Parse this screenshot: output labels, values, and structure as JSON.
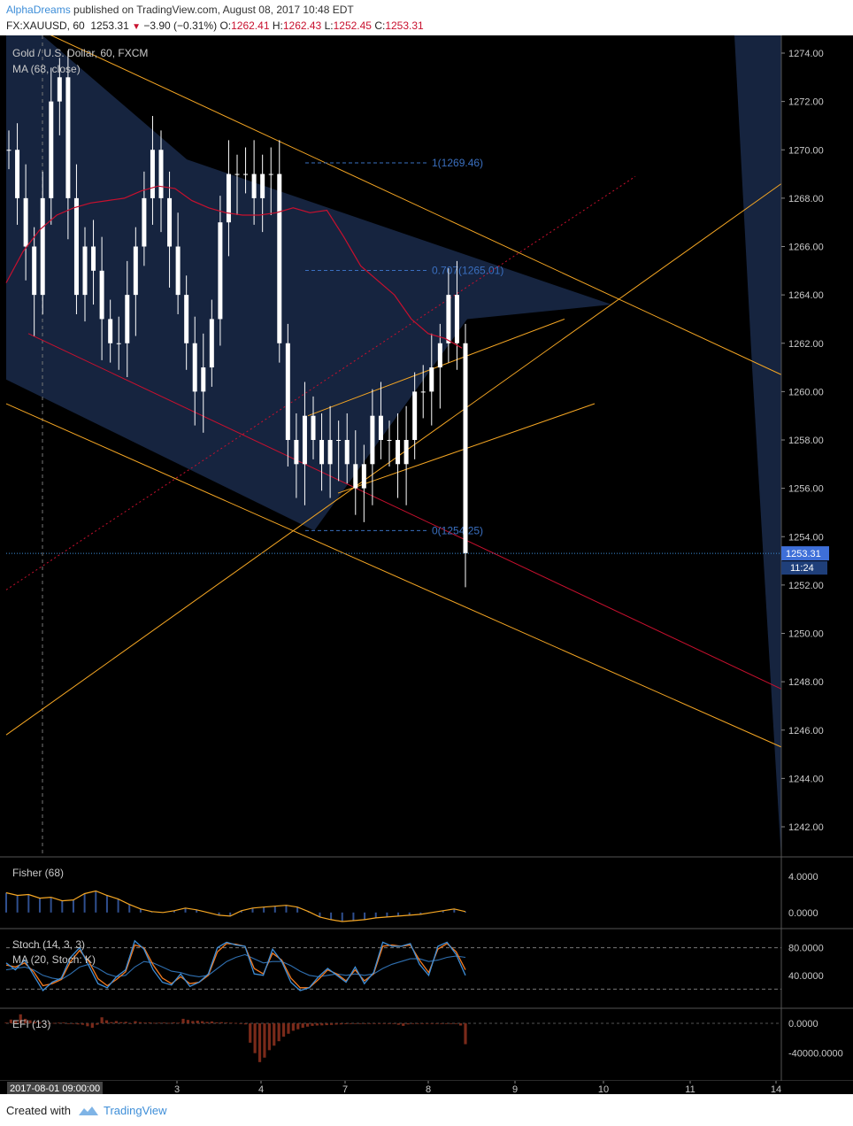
{
  "header": {
    "author": "AlphaDreams",
    "published_text": "published on TradingView.com, August 08, 2017 10:48 EDT",
    "symbol": "FX:XAUUSD, 60",
    "last": "1253.31",
    "change": "−3.90 (−0.31%)",
    "o_label": "O:",
    "o_value": "1262.41",
    "h_label": "H:",
    "h_value": "1262.43",
    "l_label": "L:",
    "l_value": "1252.45",
    "c_label": "C:",
    "c_value": "1253.31"
  },
  "footer": {
    "created_with": "Created with",
    "brand": "TradingView"
  },
  "colors": {
    "background": "#000000",
    "channel_fill": "#16243f",
    "candle": "#ffffff",
    "trendline": "#f5a623",
    "ma_line": "#c8102e",
    "fib": "#3a6fbf",
    "stoch_k": "#3e8ed8",
    "stoch_d": "#f47b20",
    "efi_bar": "#7a2a1a",
    "price_badge": "#3e6fd8"
  },
  "chart_data": [
    {
      "type": "candlestick",
      "title": "Gold / U.S. Dollar, 60, FXCM",
      "indicator_label": "MA (68, close)",
      "ylim": [
        1240.5,
        1275.5
      ],
      "y_ticks": [
        1274,
        1272,
        1270,
        1268,
        1266,
        1264,
        1262,
        1260,
        1258,
        1256,
        1254,
        1252,
        1250,
        1248,
        1246,
        1244,
        1242
      ],
      "y_tick_labels": [
        "1274.00",
        "1272.00",
        "1270.00",
        "1268.00",
        "1266.00",
        "1264.00",
        "1262.00",
        "1260.00",
        "1258.00",
        "1256.00",
        "1254.00",
        "1252.00",
        "1250.00",
        "1248.00",
        "1246.00",
        "1244.00",
        "1242.00"
      ],
      "x_range_days": [
        0.0,
        10.0
      ],
      "x_tick_days": [
        0.0,
        1.0,
        2.0,
        3.0,
        4.0,
        5.0,
        6.0,
        7.0,
        8.0,
        9.0,
        10.0
      ],
      "x_tick_labels": [
        "2017-08-01 09:00:00",
        "3",
        "4",
        "7",
        "8",
        "9",
        "10",
        "11",
        "14"
      ],
      "close_series": [
        1270,
        1268,
        1266,
        1264,
        1268,
        1272,
        1273,
        1268,
        1264,
        1266,
        1265,
        1263,
        1262,
        1262,
        1264,
        1266,
        1268,
        1270,
        1268,
        1266,
        1264,
        1262,
        1260,
        1261,
        1263,
        1267,
        1269,
        1269,
        1269,
        1268,
        1269,
        1269,
        1262,
        1258,
        1257,
        1259,
        1258,
        1257,
        1258,
        1258,
        1257,
        1256,
        1257,
        1259,
        1258,
        1258,
        1257,
        1258,
        1260,
        1260,
        1261,
        1262,
        1264,
        1262,
        1253.31
      ],
      "ma_series": [
        1264.5,
        1265.8,
        1266.7,
        1267.3,
        1267.6,
        1267.8,
        1267.9,
        1268.0,
        1268.3,
        1268.5,
        1268.4,
        1267.9,
        1267.6,
        1267.4,
        1267.3,
        1267.3,
        1267.4,
        1267.6,
        1267.4,
        1267.5,
        1266.4,
        1265.2,
        1264.6,
        1264.0,
        1263.0,
        1262.4,
        1262.2,
        1261.8
      ],
      "fib_levels": [
        {
          "label": "1(1269.46)",
          "value": 1269.46
        },
        {
          "label": "0.707(1265.01)",
          "value": 1265.01
        },
        {
          "label": "0(1254.25)",
          "value": 1254.25
        }
      ],
      "last_price_label": "1253.31",
      "countdown_label": "11:24"
    },
    {
      "type": "line",
      "title": "Fisher (68)",
      "ylim": [
        -1.2,
        5.6
      ],
      "y_ticks": [
        4.0,
        0.0
      ],
      "y_tick_labels": [
        "4.0000",
        "0.0000"
      ],
      "histogram": [
        2.2,
        1.9,
        2.0,
        1.6,
        1.7,
        1.3,
        1.4,
        2.1,
        2.4,
        1.9,
        1.5,
        0.9,
        0.4,
        0.1,
        0.0,
        0.2,
        0.5,
        0.3,
        0.0,
        -0.3,
        -0.4,
        0.2,
        0.5,
        0.6,
        0.7,
        0.8,
        0.6,
        0.1,
        -0.5,
        -0.8,
        -1.0,
        -0.9,
        -0.8,
        -0.6,
        -0.5,
        -0.4,
        -0.3,
        -0.2,
        0.0,
        0.2,
        0.4,
        0.1
      ],
      "line": [
        2.2,
        1.9,
        2.0,
        1.6,
        1.7,
        1.3,
        1.4,
        2.1,
        2.4,
        1.9,
        1.5,
        0.9,
        0.4,
        0.1,
        0.0,
        0.2,
        0.5,
        0.3,
        0.0,
        -0.3,
        -0.4,
        0.2,
        0.5,
        0.6,
        0.7,
        0.8,
        0.6,
        0.1,
        -0.5,
        -0.8,
        -1.0,
        -0.9,
        -0.8,
        -0.6,
        -0.5,
        -0.4,
        -0.3,
        -0.2,
        0.0,
        0.2,
        0.4,
        0.1
      ]
    },
    {
      "type": "line",
      "title": "Stoch (14, 3, 3)",
      "ma_label": "MA (20, Stoch: K)",
      "ylim": [
        0,
        100
      ],
      "y_ticks": [
        80,
        40
      ],
      "y_tick_labels": [
        "80.0000",
        "40.0000"
      ],
      "band_levels": [
        80,
        20
      ],
      "series": [
        {
          "values": [
            58,
            48,
            62,
            40,
            18,
            30,
            36,
            66,
            80,
            54,
            28,
            22,
            38,
            48,
            90,
            78,
            48,
            30,
            26,
            42,
            24,
            30,
            42,
            80,
            88,
            84,
            82,
            42,
            40,
            78,
            60,
            30,
            18,
            22,
            38,
            50,
            40,
            30,
            52,
            28,
            44,
            88,
            82,
            82,
            86,
            56,
            40,
            82,
            88,
            70,
            40
          ]
        },
        {
          "values": [
            55,
            52,
            58,
            45,
            25,
            28,
            34,
            60,
            76,
            60,
            35,
            25,
            34,
            45,
            84,
            80,
            55,
            36,
            28,
            38,
            28,
            30,
            40,
            74,
            86,
            85,
            82,
            50,
            42,
            72,
            62,
            36,
            22,
            22,
            34,
            48,
            42,
            32,
            48,
            32,
            42,
            82,
            84,
            82,
            84,
            62,
            44,
            78,
            86,
            74,
            48
          ]
        },
        {
          "values": [
            48,
            50,
            52,
            48,
            40,
            36,
            34,
            42,
            52,
            56,
            50,
            42,
            38,
            40,
            52,
            60,
            58,
            52,
            46,
            44,
            40,
            38,
            40,
            50,
            60,
            66,
            70,
            64,
            58,
            60,
            60,
            54,
            46,
            40,
            38,
            40,
            42,
            40,
            42,
            40,
            42,
            50,
            56,
            60,
            64,
            64,
            60,
            62,
            66,
            68,
            66
          ]
        }
      ]
    },
    {
      "type": "bar",
      "title": "EFI (13)",
      "ylim": [
        -70000,
        13000
      ],
      "y_ticks": [
        0,
        -40000
      ],
      "y_tick_labels": [
        "0.0000",
        "-40000.0000"
      ],
      "values": [
        1000,
        5000,
        3000,
        12000,
        6000,
        4000,
        2000,
        1500,
        -1000,
        -500,
        500,
        800,
        1000,
        -200,
        -300,
        -1500,
        -2000,
        -4000,
        -6000,
        -2000,
        8000,
        4000,
        1500,
        3000,
        1500,
        2000,
        -300,
        2800,
        1500,
        1000,
        1200,
        600,
        800,
        900,
        500,
        1200,
        800,
        6000,
        4500,
        3000,
        3500,
        2800,
        1800,
        2500,
        1200,
        1500,
        1000,
        800,
        500,
        -1000,
        -1500,
        -26000,
        -40000,
        -52000,
        -46000,
        -36000,
        -30000,
        -24000,
        -18000,
        -14000,
        -10000,
        -8000,
        -6000,
        -4500,
        -3500,
        -3000,
        -2800,
        -2500,
        -2200,
        -1800,
        -1500,
        -1200,
        -1000,
        -900,
        -800,
        -700,
        -600,
        -500,
        -400,
        -300,
        -200,
        -1000,
        -2000,
        -3500,
        -1500,
        -500,
        -800,
        -400,
        -300,
        -500,
        -300,
        -400,
        -300,
        -200,
        -1000,
        -3000,
        -28000
      ]
    }
  ]
}
